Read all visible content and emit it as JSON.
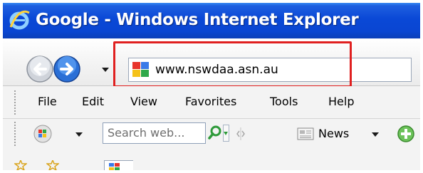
{
  "window": {
    "title": "Google - Windows Internet Explorer"
  },
  "address_bar": {
    "url": "www.nswdaa.asn.au"
  },
  "menu_bar": {
    "items": [
      "File",
      "Edit",
      "View",
      "Favorites",
      "Tools",
      "Help"
    ]
  },
  "search_toolbar": {
    "placeholder": "Search web...",
    "news_label": "News"
  },
  "colors": {
    "title_bar": "#0a46d2",
    "highlight": "#e02020",
    "back_button": "#b9bec6",
    "forward_button": "#2a6fd6"
  },
  "icons": {
    "app": "internet-explorer-icon",
    "back": "back-arrow-icon",
    "forward": "forward-arrow-icon",
    "site": "google-favicon-icon",
    "search": "magnifier-icon",
    "news": "news-icon",
    "add": "green-plus-icon"
  }
}
